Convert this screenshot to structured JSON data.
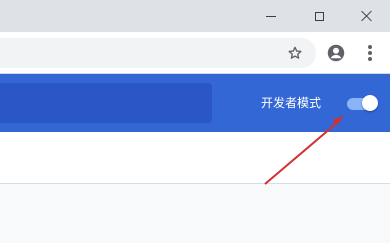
{
  "window": {
    "minimize_icon": "minimize-icon",
    "maximize_icon": "maximize-icon",
    "close_icon": "close-icon"
  },
  "toolbar": {
    "bookmark_icon": "star-icon",
    "profile_icon": "account-circle-icon",
    "menu_icon": "more-vert-icon"
  },
  "extensions_header": {
    "developer_mode_label": "开发者模式",
    "developer_mode_enabled": true
  },
  "colors": {
    "header_bg": "#3367d6",
    "search_bg": "#2a56c6",
    "toggle_track": "#8ab4f8",
    "annotation_arrow": "#d32f2f"
  }
}
